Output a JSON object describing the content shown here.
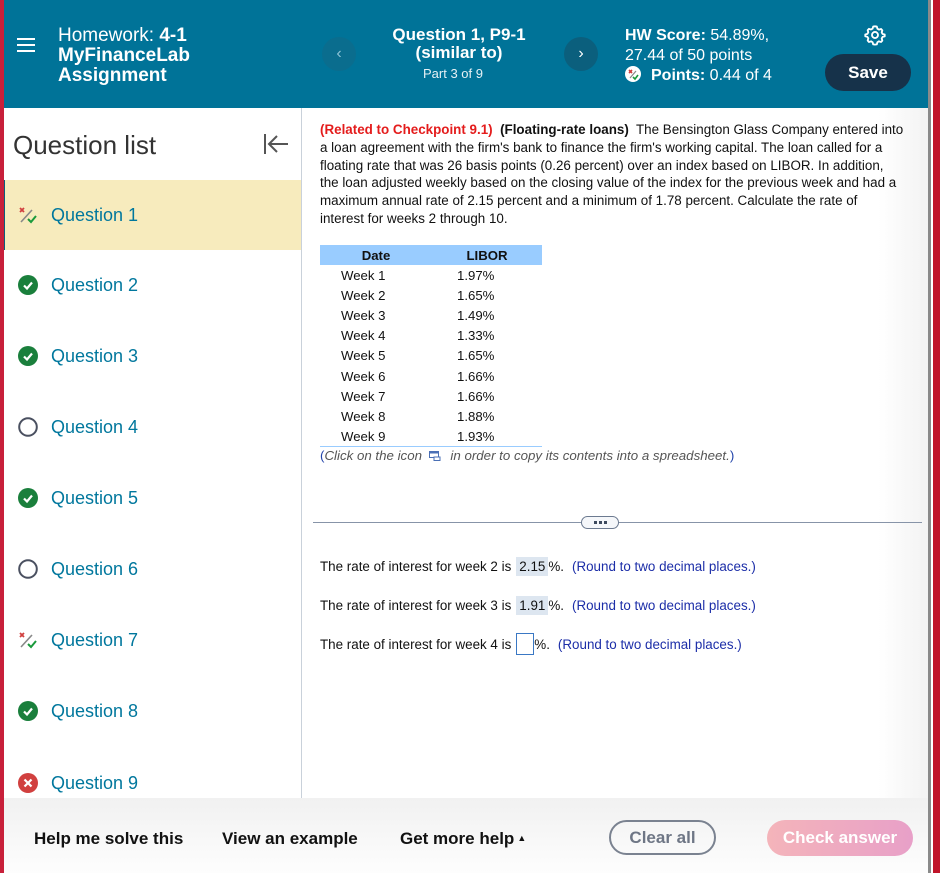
{
  "header": {
    "homework_label": "Homework:",
    "homework_number": "4-1",
    "assignment_name_line1": "MyFinanceLab",
    "assignment_name_line2": "Assignment",
    "question_title_line1": "Question 1, P9-1",
    "question_title_line2": "(similar to)",
    "part": "Part 3 of 9",
    "prev_icon": "chevron-left-icon",
    "next_icon": "chevron-right-icon",
    "hw_score_label": "HW Score:",
    "hw_score_value": "54.89%,",
    "hw_points": "27.44 of 50 points",
    "points_label": "Points:",
    "points_value": "0.44 of 4",
    "save_label": "Save"
  },
  "sidebar": {
    "title": "Question list",
    "items": [
      {
        "label": "Question 1",
        "status": "partial",
        "active": true
      },
      {
        "label": "Question 2",
        "status": "correct"
      },
      {
        "label": "Question 3",
        "status": "correct"
      },
      {
        "label": "Question 4",
        "status": "unanswered"
      },
      {
        "label": "Question 5",
        "status": "correct"
      },
      {
        "label": "Question 6",
        "status": "unanswered"
      },
      {
        "label": "Question 7",
        "status": "partial"
      },
      {
        "label": "Question 8",
        "status": "correct"
      },
      {
        "label": "Question 9",
        "status": "incorrect"
      }
    ]
  },
  "problem": {
    "related": "(Related to Checkpoint 9.1)",
    "topic": "(Floating-rate loans)",
    "text": "The Bensington Glass Company entered into a loan agreement with the firm's bank to finance the firm's working capital.  The loan called for a floating rate that was 26 basis points (0.26 percent) over an index based on LIBOR.  In addition, the loan adjusted weekly based on the closing value of the index for the previous week and had a maximum annual rate of 2.15 percent and a minimum of 1.78 percent.  Calculate the rate of interest for weeks 2 through 10."
  },
  "table": {
    "headers": [
      "Date",
      "LIBOR"
    ],
    "rows": [
      [
        "Week 1",
        "1.97%"
      ],
      [
        "Week 2",
        "1.65%"
      ],
      [
        "Week 3",
        "1.49%"
      ],
      [
        "Week 4",
        "1.33%"
      ],
      [
        "Week 5",
        "1.65%"
      ],
      [
        "Week 6",
        "1.66%"
      ],
      [
        "Week 7",
        "1.66%"
      ],
      [
        "Week 8",
        "1.88%"
      ],
      [
        "Week 9",
        "1.93%"
      ]
    ]
  },
  "copy_note": {
    "open": "(",
    "before": "Click on the icon",
    "after": "in order to copy its contents into a spreadsheet.",
    "close": ")"
  },
  "answers": [
    {
      "prefix": "The rate of interest for week 2 is",
      "value": "2.15",
      "suffix": "%.",
      "hint": "(Round to two decimal places.)"
    },
    {
      "prefix": "The rate of interest for week 3 is",
      "value": "1.91",
      "suffix": "%.",
      "hint": "(Round to two decimal places.)"
    },
    {
      "prefix": "The rate of interest for week 4 is",
      "value": "",
      "suffix": "%.",
      "hint": "(Round to two decimal places.)"
    }
  ],
  "footer": {
    "help_solve": "Help me solve this",
    "view_example": "View an example",
    "more_help": "Get more help",
    "clear_all": "Clear all",
    "check_answer": "Check answer"
  },
  "colors": {
    "header_bg": "#007398",
    "active_item_bg": "#f7ebbd",
    "link": "#00779d",
    "correct": "#1a7f3c",
    "incorrect": "#d1403f",
    "related_red": "#e41c1c"
  }
}
